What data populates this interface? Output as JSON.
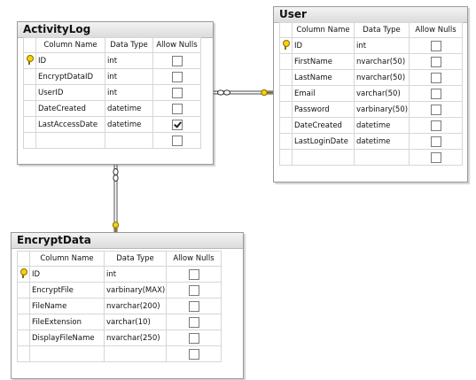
{
  "headers": {
    "column_name": "Column Name",
    "data_type": "Data Type",
    "allow_nulls": "Allow Nulls"
  },
  "activity_log": {
    "title": "ActivityLog",
    "rows": [
      {
        "name": "ID",
        "type": "int",
        "pk": true,
        "nullable": false
      },
      {
        "name": "EncryptDataID",
        "type": "int",
        "pk": false,
        "nullable": false
      },
      {
        "name": "UserID",
        "type": "int",
        "pk": false,
        "nullable": false
      },
      {
        "name": "DateCreated",
        "type": "datetime",
        "pk": false,
        "nullable": false
      },
      {
        "name": "LastAccessDate",
        "type": "datetime",
        "pk": false,
        "nullable": true
      },
      {
        "name": "",
        "type": "",
        "pk": false,
        "nullable": false
      }
    ]
  },
  "user": {
    "title": "User",
    "rows": [
      {
        "name": "ID",
        "type": "int",
        "pk": true,
        "nullable": false
      },
      {
        "name": "FirstName",
        "type": "nvarchar(50)",
        "pk": false,
        "nullable": false
      },
      {
        "name": "LastName",
        "type": "nvarchar(50)",
        "pk": false,
        "nullable": false
      },
      {
        "name": "Email",
        "type": "varchar(50)",
        "pk": false,
        "nullable": false
      },
      {
        "name": "Password",
        "type": "varbinary(50)",
        "pk": false,
        "nullable": false
      },
      {
        "name": "DateCreated",
        "type": "datetime",
        "pk": false,
        "nullable": false
      },
      {
        "name": "LastLoginDate",
        "type": "datetime",
        "pk": false,
        "nullable": false
      },
      {
        "name": "",
        "type": "",
        "pk": false,
        "nullable": false
      }
    ]
  },
  "encrypt_data": {
    "title": "EncryptData",
    "rows": [
      {
        "name": "ID",
        "type": "int",
        "pk": true,
        "nullable": false
      },
      {
        "name": "EncryptFile",
        "type": "varbinary(MAX)",
        "pk": false,
        "nullable": false
      },
      {
        "name": "FileName",
        "type": "nvarchar(200)",
        "pk": false,
        "nullable": false
      },
      {
        "name": "FileExtension",
        "type": "varchar(10)",
        "pk": false,
        "nullable": false
      },
      {
        "name": "DisplayFileName",
        "type": "nvarchar(250)",
        "pk": false,
        "nullable": false
      },
      {
        "name": "",
        "type": "",
        "pk": false,
        "nullable": false
      }
    ]
  },
  "relationships": [
    {
      "from": "activity_log",
      "to": "user",
      "many_side": "activity_log",
      "one_side": "user"
    },
    {
      "from": "activity_log",
      "to": "encrypt_data",
      "many_side": "activity_log",
      "one_side": "encrypt_data"
    }
  ],
  "colors": {
    "key": "#f5d20c",
    "line": "#6e6e6e",
    "border": "#9a9a9a"
  }
}
